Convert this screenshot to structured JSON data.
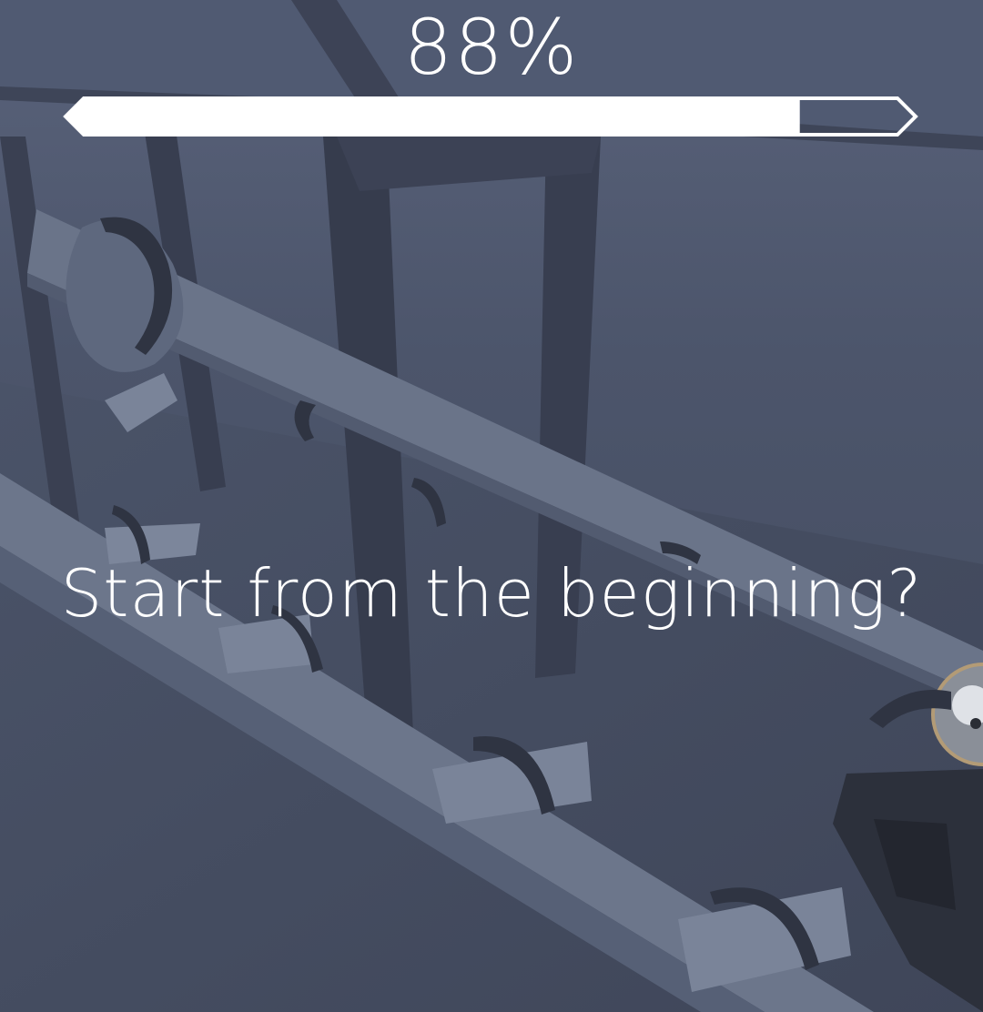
{
  "hud": {
    "progress_text": "88%",
    "progress_value": 0.88
  },
  "prompt": {
    "restart_text": "Start from the beginning?"
  },
  "colors": {
    "background": "#4a5266",
    "bar_fill": "#ffffff",
    "bar_outline": "#ffffff",
    "text": "#ffffff"
  }
}
